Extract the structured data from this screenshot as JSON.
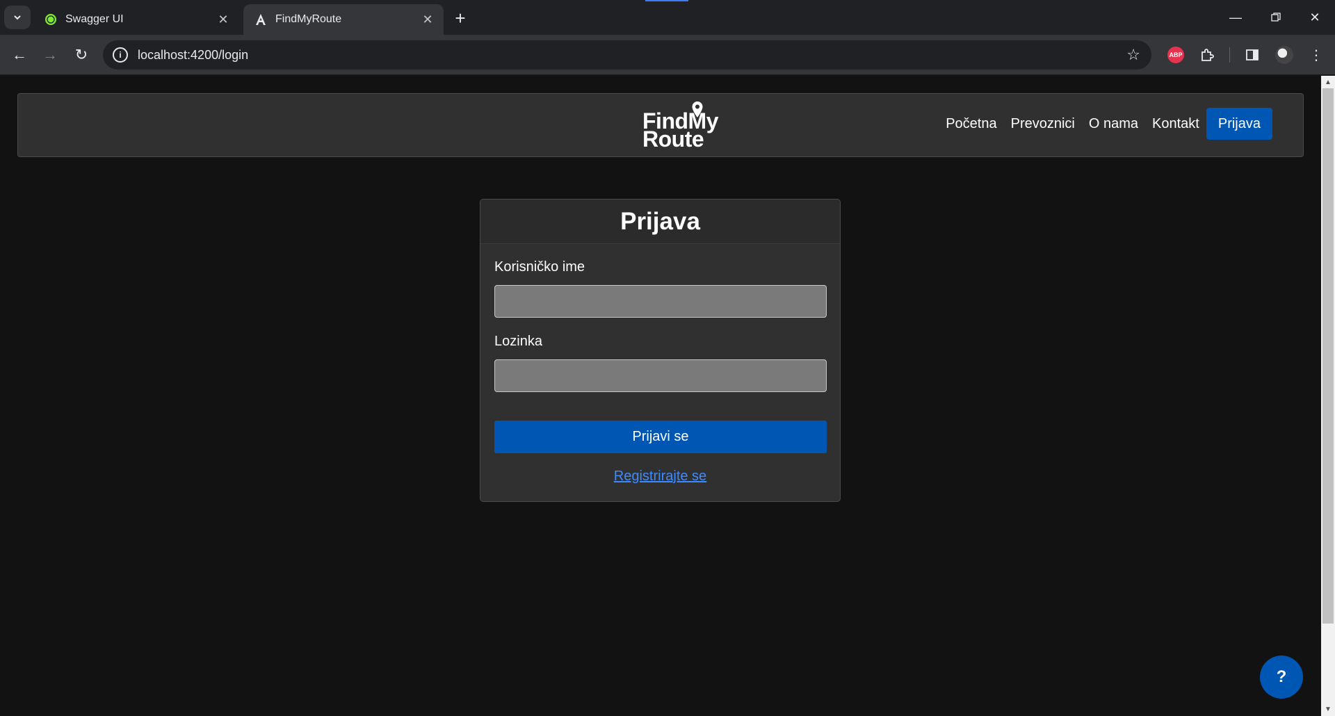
{
  "browser": {
    "tabs": [
      {
        "title": "Swagger UI",
        "icon": "swagger-icon",
        "active": false
      },
      {
        "title": "FindMyRoute",
        "icon": "angular-icon",
        "active": true
      }
    ],
    "url": "localhost:4200/login",
    "extensions": {
      "abp_label": "ABP"
    }
  },
  "navbar": {
    "logo_line1": "FindMy",
    "logo_line2": "Route",
    "links": [
      "Početna",
      "Prevoznici",
      "O nama",
      "Kontakt"
    ],
    "login_label": "Prijava"
  },
  "login_form": {
    "title": "Prijava",
    "username_label": "Korisničko ime",
    "username_value": "",
    "password_label": "Lozinka",
    "password_value": "",
    "submit_label": "Prijavi se",
    "register_link": "Registrirajte se"
  },
  "help_button": {
    "label": "?"
  },
  "colors": {
    "primary": "#0056b3",
    "link": "#3d8bfd",
    "page_bg": "#121212",
    "card_bg": "#303030"
  }
}
